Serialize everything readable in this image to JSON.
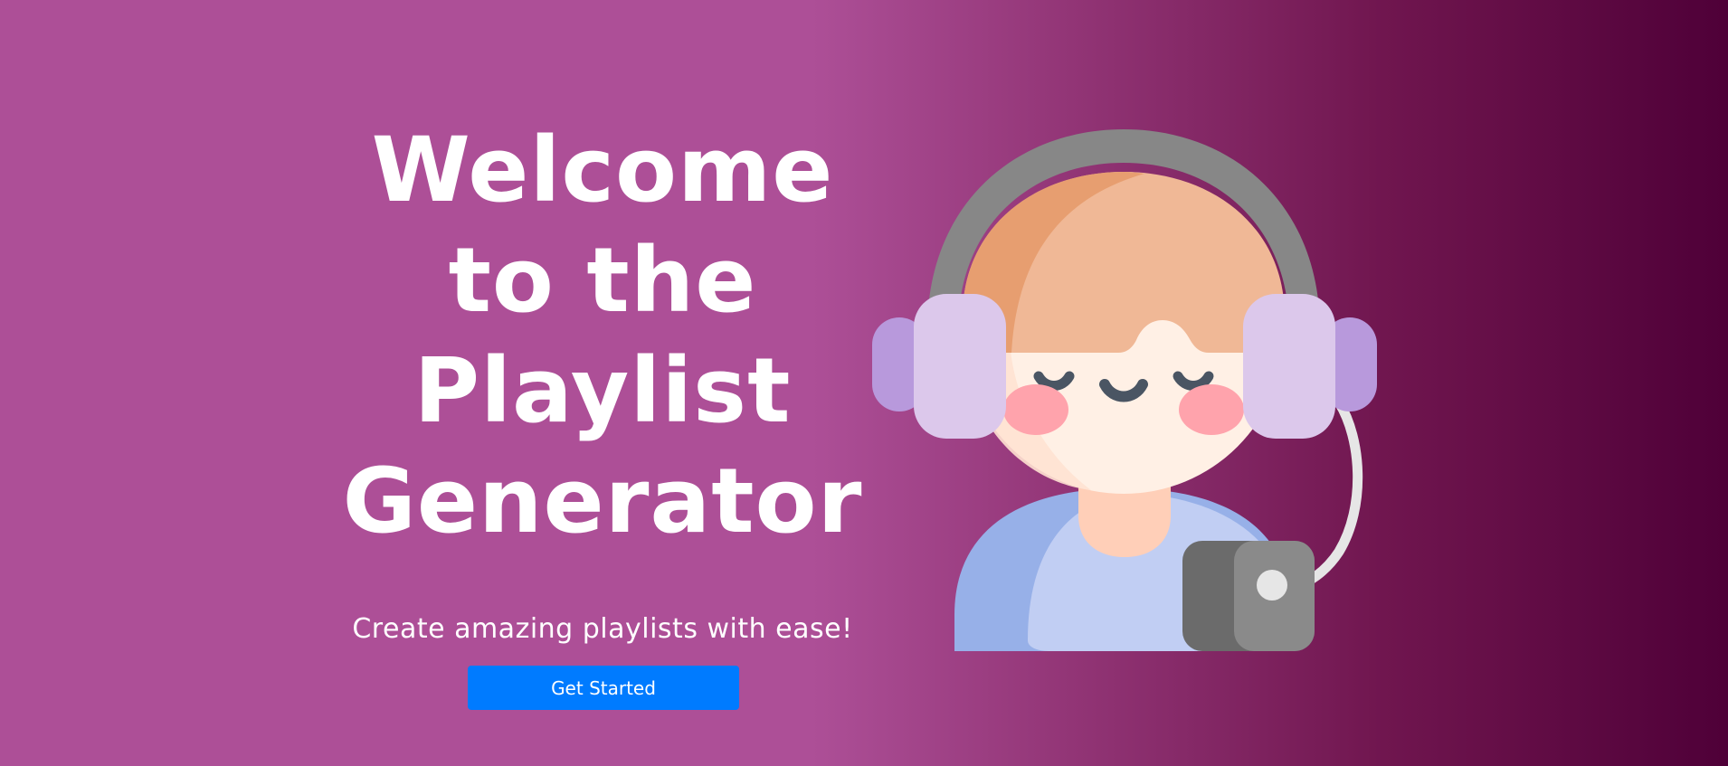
{
  "hero": {
    "title_lines": [
      "Welcome",
      "to the",
      "Playlist",
      "Generator"
    ],
    "subtitle": "Create amazing playlists with ease!",
    "cta_label": "Get Started",
    "illustration_icon": "listener-with-headphones-icon"
  },
  "colors": {
    "background_start": "#ad4f97",
    "background_end": "#4f0038",
    "button": "#007bff",
    "text": "#ffffff"
  }
}
